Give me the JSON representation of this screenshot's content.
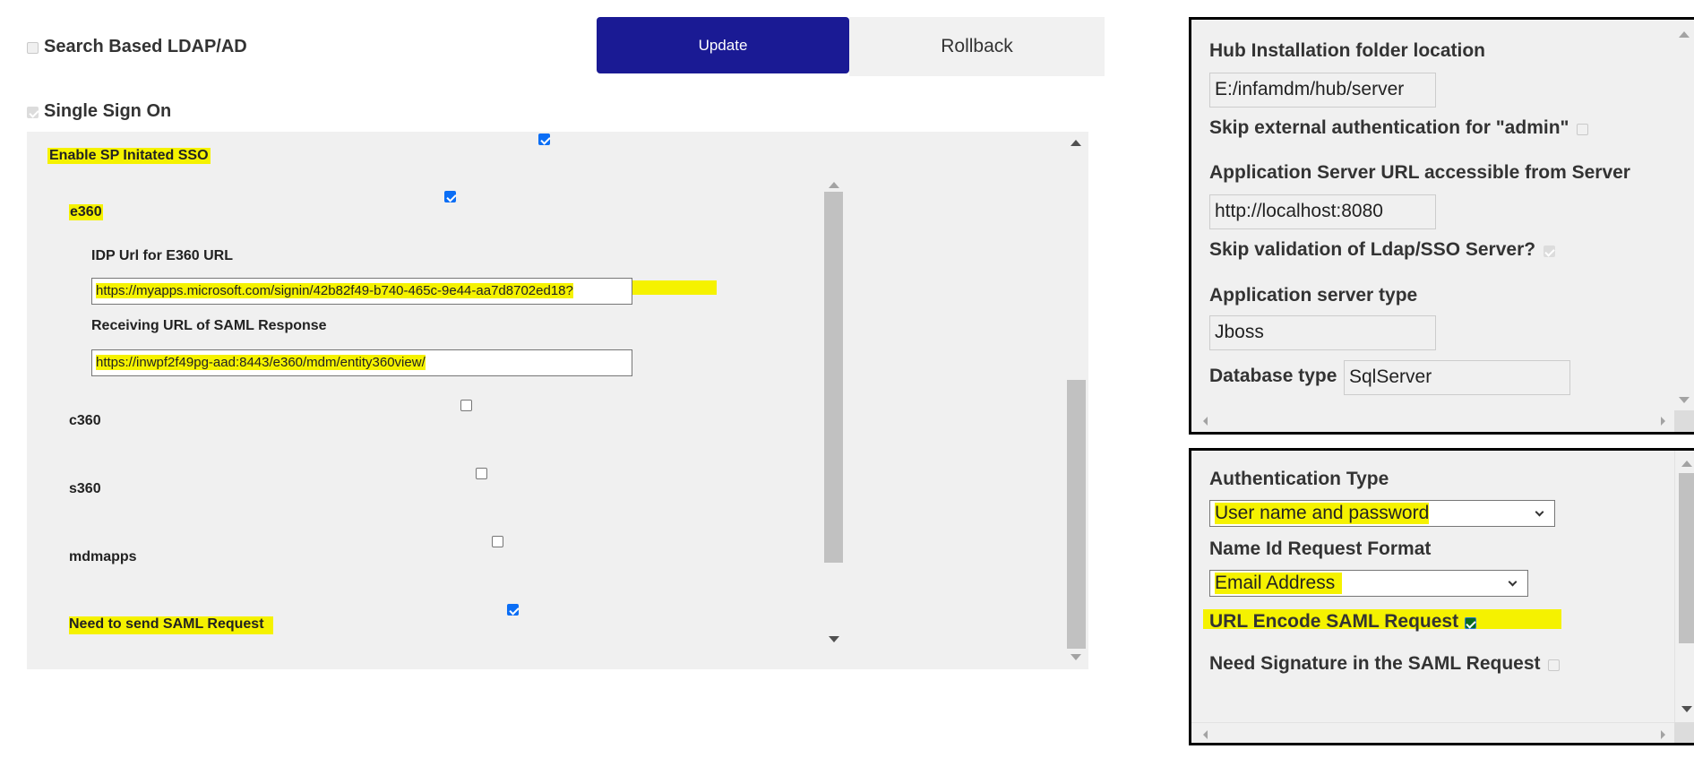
{
  "top": {
    "search_ldap": {
      "label": "Search Based LDAP/AD",
      "checked": false
    },
    "single_sign_on": {
      "label": "Single Sign On",
      "checked": true
    },
    "update_label": "Update",
    "rollback_label": "Rollback"
  },
  "sso": {
    "enable_sp_label": "Enable SP Initated SSO",
    "enable_sp_checked": true,
    "apps": [
      {
        "name": "e360",
        "checked": true
      },
      {
        "name": "c360",
        "checked": false
      },
      {
        "name": "s360",
        "checked": false
      },
      {
        "name": "mdmapps",
        "checked": false
      }
    ],
    "idp_url_label": "IDP Url for E360 URL",
    "idp_url_value": "https://myapps.microsoft.com/signin/42b82f49-b740-465c-9e44-aa7d8702ed18?",
    "receiving_url_label": "Receiving URL of SAML Response",
    "receiving_url_value": "https://inwpf2f49pg-aad:8443/e360/mdm/entity360view/",
    "need_saml_label": "Need to send SAML Request",
    "need_saml_checked": true
  },
  "server_panel": {
    "hub_label": "Hub Installation folder location",
    "hub_value": "E:/infamdm/hub/server",
    "skip_admin_label": "Skip external authentication for \"admin\"",
    "skip_admin_checked": false,
    "app_url_label": "Application Server URL accessible from Server",
    "app_url_value": "http://localhost:8080",
    "skip_validation_label": "Skip validation of Ldap/SSO Server?",
    "skip_validation_checked": true,
    "app_type_label": "Application server type",
    "app_type_value": "Jboss",
    "db_type_label": "Database type",
    "db_type_value": "SqlServer"
  },
  "auth_panel": {
    "auth_type_label": "Authentication Type",
    "auth_type_value": "User name and password",
    "name_id_label": "Name Id Request Format",
    "name_id_value": "Email Address",
    "url_encode_label": "URL Encode SAML Request",
    "url_encode_checked": true,
    "need_signature_label": "Need Signature in the SAML Request",
    "need_signature_checked": false
  },
  "colors": {
    "update_button": "#1a1a94",
    "highlight": "#f5f200",
    "panel_bg": "#f0f0f0"
  }
}
